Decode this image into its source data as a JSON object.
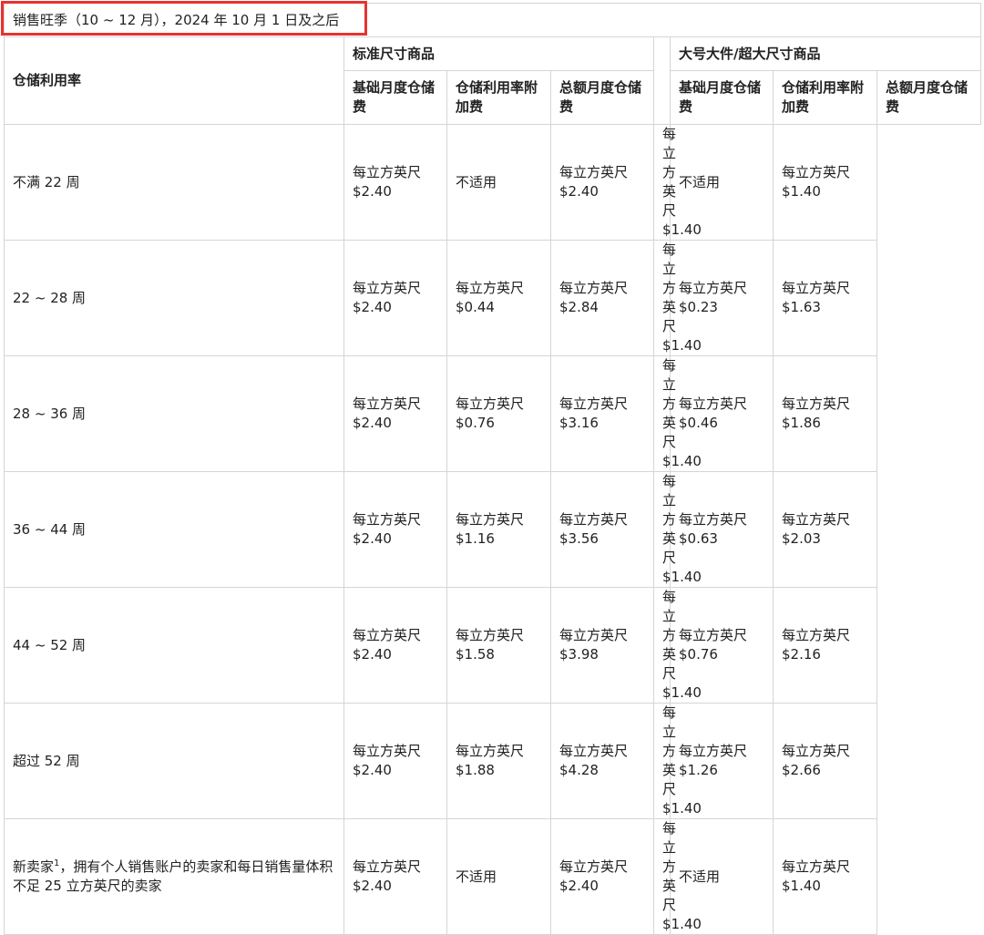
{
  "title": "销售旺季（10 ~ 12 月），2024 年 10 月 1 日及之后",
  "row_header": "仓储利用率",
  "groups": {
    "standard": "标准尺寸商品",
    "oversize": "大号大件/超大尺寸商品"
  },
  "columns": {
    "base_fee": "基础月度仓储费",
    "surcharge": "仓储利用率附加费",
    "total_fee": "总额月度仓储费"
  },
  "unit_prefix": "每立方英尺",
  "not_applicable": "不适用",
  "rows": [
    {
      "label": "不满 22 周",
      "std_base": "$2.40",
      "std_sur": "不适用",
      "std_total": "$2.40",
      "ov_base": "$1.40",
      "ov_sur": "不适用",
      "ov_total": "$1.40"
    },
    {
      "label": "22 ~ 28 周",
      "std_base": "$2.40",
      "std_sur": "$0.44",
      "std_total": "$2.84",
      "ov_base": "$1.40",
      "ov_sur": "$0.23",
      "ov_total": "$1.63"
    },
    {
      "label": "28 ~ 36 周",
      "std_base": "$2.40",
      "std_sur": "$0.76",
      "std_total": "$3.16",
      "ov_base": "$1.40",
      "ov_sur": "$0.46",
      "ov_total": "$1.86"
    },
    {
      "label": "36 ~ 44 周",
      "std_base": "$2.40",
      "std_sur": "$1.16",
      "std_total": "$3.56",
      "ov_base": "$1.40",
      "ov_sur": "$0.63",
      "ov_total": "$2.03"
    },
    {
      "label": "44 ~ 52 周",
      "std_base": "$2.40",
      "std_sur": "$1.58",
      "std_total": "$3.98",
      "ov_base": "$1.40",
      "ov_sur": "$0.76",
      "ov_total": "$2.16"
    },
    {
      "label": "超过 52 周",
      "std_base": "$2.40",
      "std_sur": "$1.88",
      "std_total": "$4.28",
      "ov_base": "$1.40",
      "ov_sur": "$1.26",
      "ov_total": "$2.66"
    }
  ],
  "new_seller": {
    "label_prefix": "新卖家",
    "footnote": "1",
    "label_suffix": "，拥有个人销售账户的卖家和每日销售量体积不足 25 立方英尺的卖家",
    "std_base": "$2.40",
    "std_sur": "不适用",
    "std_total": "$2.40",
    "ov_base": "$1.40",
    "ov_sur": "不适用",
    "ov_total": "$1.40"
  },
  "colors": {
    "highlight_border": "#e8322f",
    "grid": "#d5d5d5",
    "text": "#222222"
  }
}
